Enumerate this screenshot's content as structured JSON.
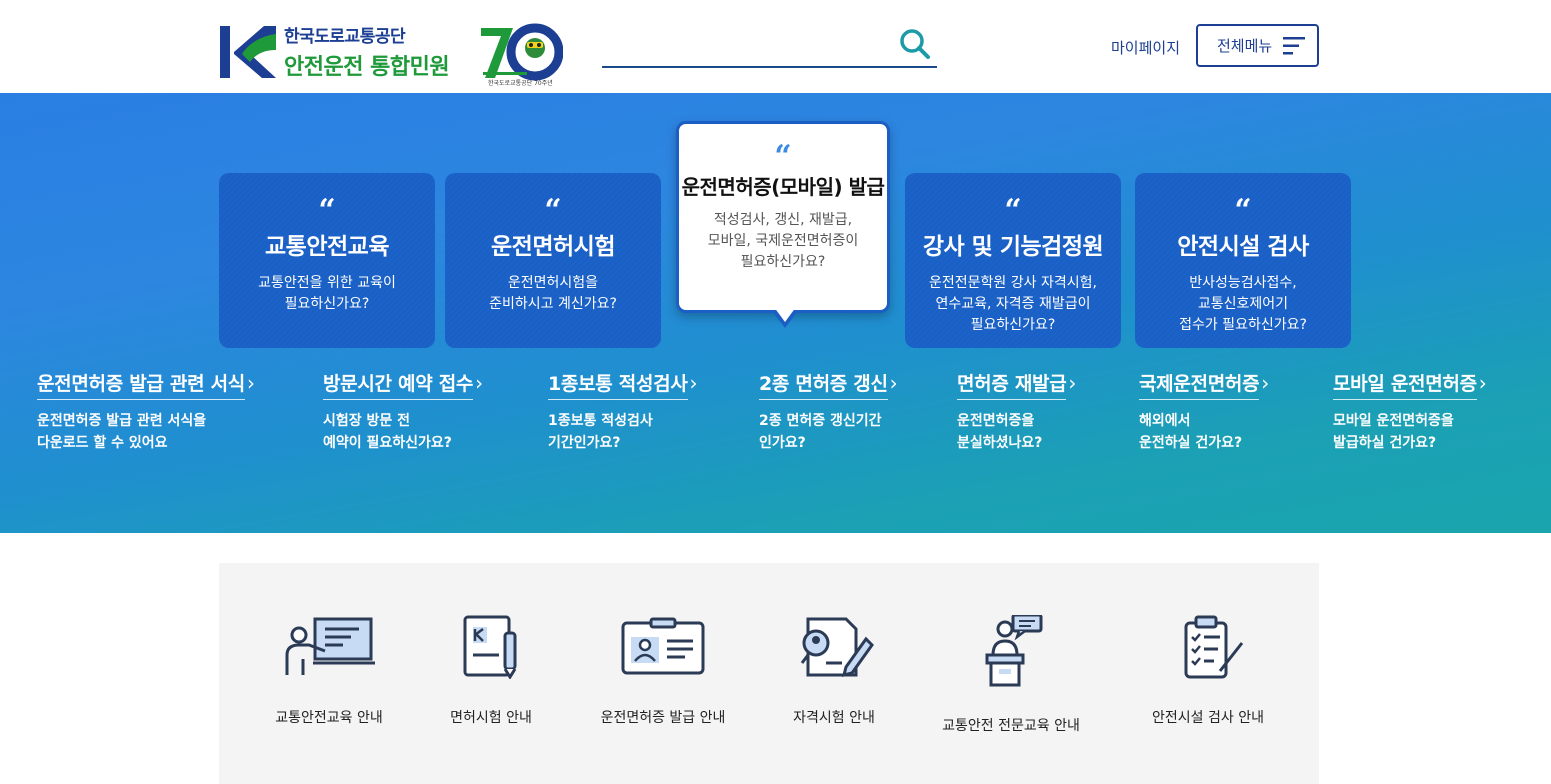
{
  "header": {
    "org_name": "한국도로교통공단",
    "service_name": "안전운전 통합민원",
    "anniversary_caption": "한국도로교통공단 70주년",
    "search_placeholder": "",
    "mypage_label": "마이페이지",
    "allmenu_label": "전체메뉴"
  },
  "colors": {
    "brand_navy": "#1c3f94",
    "brand_green": "#1f9a3a",
    "hero_blue": "#2a7fe3",
    "hero_teal": "#1aa5ad"
  },
  "hero": {
    "cards": [
      {
        "title": "교통안전교육",
        "desc_line1": "교통안전을 위한 교육이",
        "desc_line2": "필요하신가요?",
        "desc_line3": ""
      },
      {
        "title": "운전면허시험",
        "desc_line1": "운전면허시험을",
        "desc_line2": "준비하시고 계신가요?",
        "desc_line3": ""
      },
      {
        "title": "운전면허증(모바일) 발급",
        "desc_line1": "적성검사, 갱신, 재발급,",
        "desc_line2": "모바일, 국제운전면허증이",
        "desc_line3": "필요하신가요?"
      },
      {
        "title": "강사 및 기능검정원",
        "desc_line1": "운전전문학원 강사 자격시험,",
        "desc_line2": "연수교육, 자격증 재발급이",
        "desc_line3": "필요하신가요?"
      },
      {
        "title": "안전시설 검사",
        "desc_line1": "반사성능검사접수,",
        "desc_line2": "교통신호제어기",
        "desc_line3": "접수가 필요하신가요?"
      }
    ],
    "quote_mark": "“",
    "chevron": "›",
    "sublinks": [
      {
        "title": "운전면허증 발급 관련 서식",
        "desc_line1": "운전면허증 발급 관련 서식을",
        "desc_line2": "다운로드 할 수 있어요"
      },
      {
        "title": "방문시간 예약 접수",
        "desc_line1": "시험장 방문 전",
        "desc_line2": "예약이 필요하신가요?"
      },
      {
        "title": "1종보통 적성검사",
        "desc_line1": "1종보통 적성검사",
        "desc_line2": "기간인가요?"
      },
      {
        "title": "2종 면허증 갱신",
        "desc_line1": "2종 면허증 갱신기간",
        "desc_line2": "인가요?"
      },
      {
        "title": "면허증 재발급",
        "desc_line1": "운전면허증을",
        "desc_line2": "분실하셨나요?"
      },
      {
        "title": "국제운전면허증",
        "desc_line1": "해외에서",
        "desc_line2": "운전하실 건가요?"
      },
      {
        "title": "모바일 운전면허증",
        "desc_line1": "모바일 운전면허증을",
        "desc_line2": "발급하실 건가요?"
      }
    ]
  },
  "services": [
    {
      "label": "교통안전교육 안내",
      "icon": "presentation-icon"
    },
    {
      "label": "면허시험 안내",
      "icon": "license-book-icon"
    },
    {
      "label": "운전면허증 발급 안내",
      "icon": "id-card-icon"
    },
    {
      "label": "자격시험 안내",
      "icon": "exam-document-icon"
    },
    {
      "label": "교통안전 전문교육 안내",
      "icon": "lecturer-podium-icon"
    },
    {
      "label": "안전시설 검사 안내",
      "icon": "clipboard-checklist-icon"
    }
  ]
}
